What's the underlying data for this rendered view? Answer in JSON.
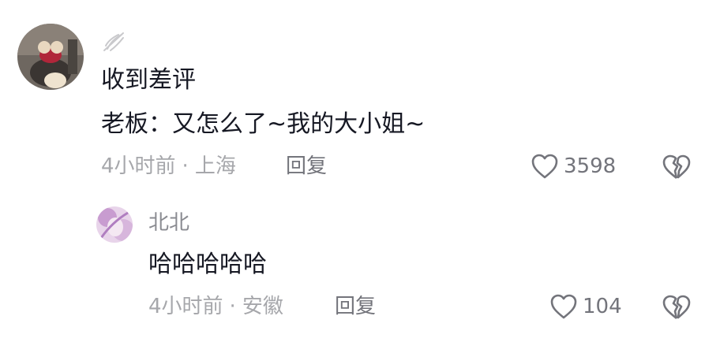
{
  "comments": [
    {
      "username_icon": "wing-icon",
      "lines": [
        "收到差评",
        "老板：又怎么了~我的大小姐~"
      ],
      "time": "4小时前",
      "separator": "·",
      "location": "上海",
      "reply_label": "回复",
      "like_count": "3598"
    }
  ],
  "replies": [
    {
      "username": "北北",
      "text": "哈哈哈哈哈",
      "time": "4小时前",
      "separator": "·",
      "location": "安徽",
      "reply_label": "回复",
      "like_count": "104"
    }
  ],
  "icons": {
    "like": "heart-outline-icon",
    "dislike": "broken-heart-icon"
  },
  "colors": {
    "text_primary": "#161823",
    "text_secondary": "#a6a7ab",
    "action_gray": "#73747b"
  }
}
